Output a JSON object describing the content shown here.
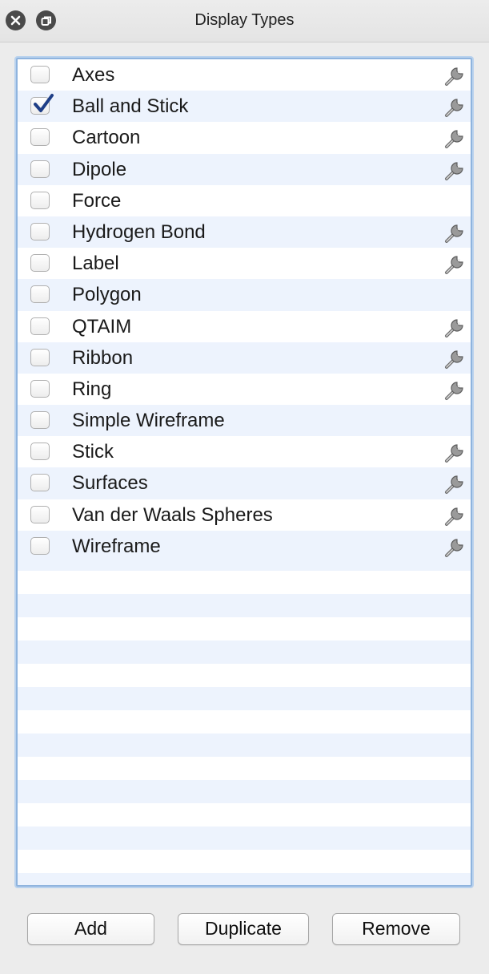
{
  "window": {
    "title": "Display Types"
  },
  "titlebar_icons": {
    "close": "close-icon",
    "restore": "restore-icon"
  },
  "list": {
    "items": [
      {
        "label": "Axes",
        "checked": false,
        "has_settings": true
      },
      {
        "label": "Ball and Stick",
        "checked": true,
        "has_settings": true
      },
      {
        "label": "Cartoon",
        "checked": false,
        "has_settings": true
      },
      {
        "label": "Dipole",
        "checked": false,
        "has_settings": true
      },
      {
        "label": "Force",
        "checked": false,
        "has_settings": false
      },
      {
        "label": "Hydrogen Bond",
        "checked": false,
        "has_settings": true
      },
      {
        "label": "Label",
        "checked": false,
        "has_settings": true
      },
      {
        "label": "Polygon",
        "checked": false,
        "has_settings": false
      },
      {
        "label": "QTAIM",
        "checked": false,
        "has_settings": true
      },
      {
        "label": "Ribbon",
        "checked": false,
        "has_settings": true
      },
      {
        "label": "Ring",
        "checked": false,
        "has_settings": true
      },
      {
        "label": "Simple Wireframe",
        "checked": false,
        "has_settings": false
      },
      {
        "label": "Stick",
        "checked": false,
        "has_settings": true
      },
      {
        "label": "Surfaces",
        "checked": false,
        "has_settings": true
      },
      {
        "label": "Van der Waals Spheres",
        "checked": false,
        "has_settings": true
      },
      {
        "label": "Wireframe",
        "checked": false,
        "has_settings": true
      }
    ],
    "settings_icon": "wrench-icon"
  },
  "buttons": {
    "add": "Add",
    "duplicate": "Duplicate",
    "remove": "Remove"
  },
  "colors": {
    "selection_border": "#8fb4de",
    "check": "#1f3f87",
    "alt_row": "#edf3fd"
  }
}
